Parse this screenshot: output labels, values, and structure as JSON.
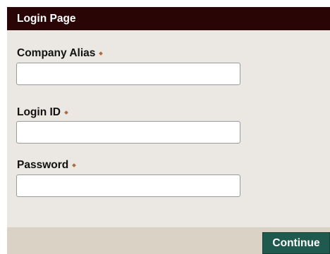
{
  "header": {
    "title": "Login Page"
  },
  "form": {
    "company_alias": {
      "label": "Company Alias",
      "value": "",
      "placeholder": ""
    },
    "login_id": {
      "label": "Login ID",
      "value": "",
      "placeholder": ""
    },
    "password": {
      "label": "Password",
      "value": "",
      "placeholder": ""
    },
    "required_marker_icon": "diamond-icon"
  },
  "footer": {
    "continue_label": "Continue"
  },
  "colors": {
    "header_bg": "#2a0505",
    "panel_bg": "#ebe8e3",
    "footer_bg": "#d9d2c5",
    "button_bg": "#1f5a4e",
    "required_marker": "#b06a3a"
  }
}
